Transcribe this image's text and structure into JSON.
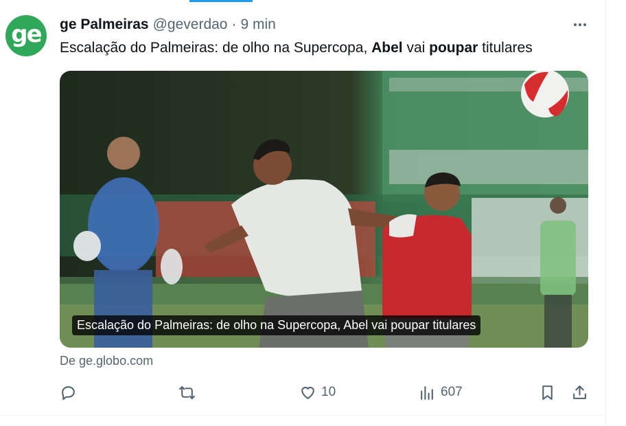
{
  "author": {
    "avatar_text": "ge",
    "name": "ge Palmeiras",
    "handle": "@geverdao",
    "separator": "·",
    "time": "9 min"
  },
  "tweet": {
    "text_1": "Escalação do Palmeiras: de olho na Supercopa, ",
    "bold_1": "Abel",
    "text_2": " vai ",
    "bold_2": "poupar",
    "text_3": " titulares"
  },
  "card": {
    "caption": "Escalação do Palmeiras: de olho na Supercopa, Abel vai poupar titulares",
    "source": "De ge.globo.com"
  },
  "actions": {
    "reply_count": "",
    "retweet_count": "",
    "like_count": "10",
    "views_count": "607"
  },
  "colors": {
    "avatar_bg": "#2fa85a",
    "accent": "#1d9bf0",
    "secondary_text": "#536471"
  },
  "icons": [
    "more-icon",
    "reply-icon",
    "retweet-icon",
    "like-icon",
    "views-icon",
    "bookmark-icon",
    "share-icon"
  ]
}
